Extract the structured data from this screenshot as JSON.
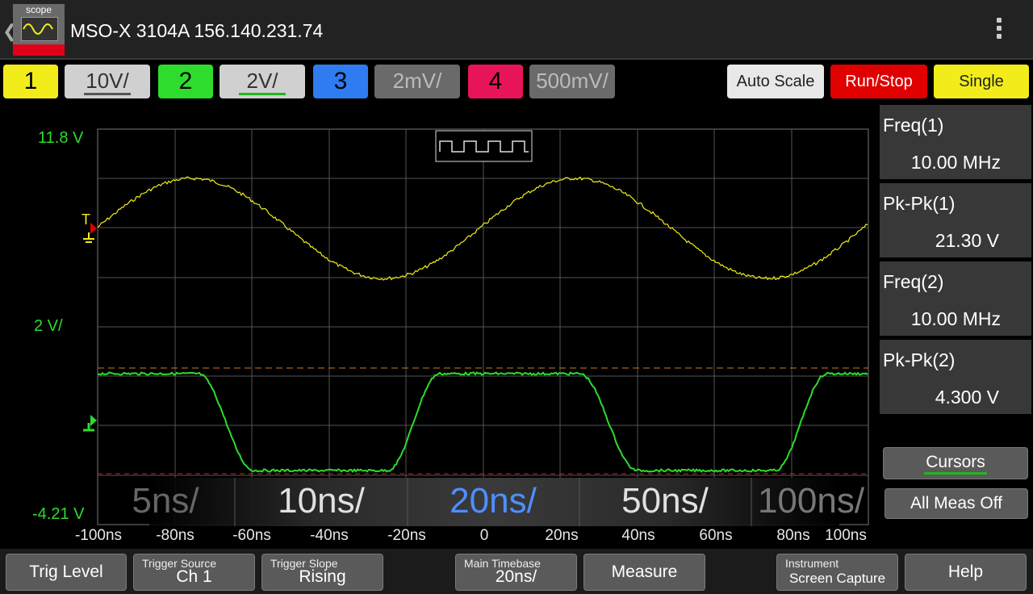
{
  "titlebar": {
    "app_icon_label": "scope",
    "title": "MSO-X 3104A 156.140.231.74",
    "back_glyph": "❮"
  },
  "channels": [
    {
      "label": "1",
      "scale": "10V/",
      "color": "#f2ec1a",
      "underline": "#555555"
    },
    {
      "label": "2",
      "scale": "2V/",
      "color": "#2ddc2d",
      "underline": "#1fb81f"
    },
    {
      "label": "3",
      "scale": "2mV/",
      "color": "#2e7cf0",
      "underline": ""
    },
    {
      "label": "4",
      "scale": "500mV/",
      "color": "#e8145a",
      "underline": ""
    }
  ],
  "top_buttons": {
    "auto_scale": "Auto Scale",
    "run_stop": "Run/Stop",
    "single": "Single"
  },
  "display": {
    "top_voltage": "11.8 V",
    "scale_label": "2 V/",
    "bottom_voltage": "-4.21 V",
    "trigger_marker": "T",
    "time_labels": [
      "-100ns",
      "-80ns",
      "-60ns",
      "-40ns",
      "-20ns",
      "0",
      "20ns",
      "40ns",
      "60ns",
      "80ns",
      "100ns"
    ]
  },
  "timebase_selector": {
    "options": [
      "5ns/",
      "10ns/",
      "20ns/",
      "50ns/",
      "100ns/"
    ],
    "selected": "20ns/"
  },
  "measurements": [
    {
      "label": "Freq(1)",
      "value": "10.00 MHz"
    },
    {
      "label": "Pk-Pk(1)",
      "value": "21.30 V"
    },
    {
      "label": "Freq(2)",
      "value": "10.00 MHz"
    },
    {
      "label": "Pk-Pk(2)",
      "value": "4.300 V"
    }
  ],
  "side_buttons": {
    "cursors": "Cursors",
    "all_meas_off": "All Meas Off"
  },
  "bottom": {
    "trig_level": "Trig Level",
    "trigger_source_caption": "Trigger Source",
    "trigger_source_value": "Ch 1",
    "trigger_slope_caption": "Trigger Slope",
    "trigger_slope_value": "Rising",
    "main_timebase_caption": "Main Timebase",
    "main_timebase_value": "20ns/",
    "measure": "Measure",
    "instrument_caption": "Instrument",
    "instrument_value": "Screen Capture",
    "help": "Help"
  },
  "colors": {
    "ch1": "#f2ec1a",
    "ch2": "#2ddc2d",
    "ch3": "#2e7cf0",
    "ch4": "#e8145a",
    "run_stop": "#e00000",
    "single": "#f2ec1a",
    "selected_timebase": "#4d8fff"
  }
}
